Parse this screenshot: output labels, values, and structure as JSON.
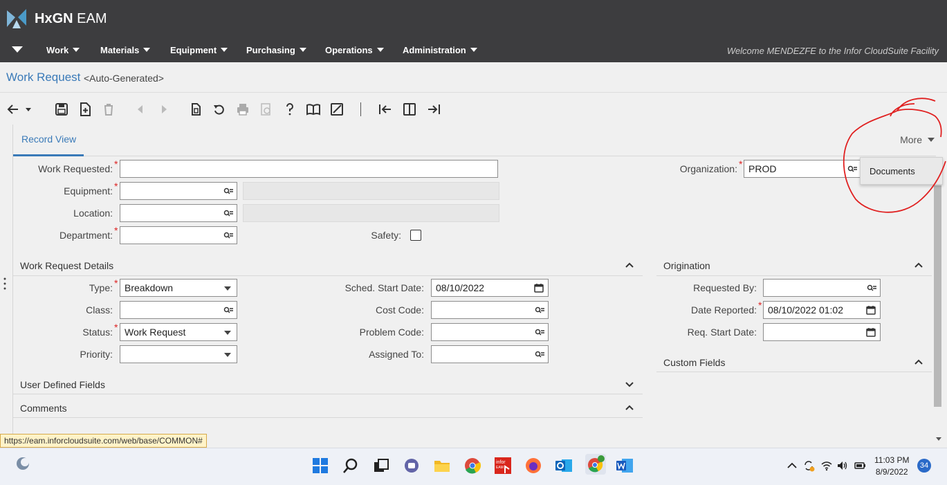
{
  "app": {
    "brand_bold": "HxGN",
    "brand_rest": " EAM"
  },
  "nav": {
    "items": [
      "Work",
      "Materials",
      "Equipment",
      "Purchasing",
      "Operations",
      "Administration"
    ],
    "welcome": "Welcome MENDEZFE to the Infor CloudSuite Facility"
  },
  "title": {
    "main": "Work Request",
    "sub": "<Auto-Generated>"
  },
  "tabs": {
    "record_view": "Record View",
    "more": "More"
  },
  "menu": {
    "documents": "Documents"
  },
  "header_fields": {
    "work_requested": {
      "label": "Work Requested:",
      "value": ""
    },
    "equipment": {
      "label": "Equipment:",
      "value": ""
    },
    "location": {
      "label": "Location:",
      "value": ""
    },
    "department": {
      "label": "Department:",
      "value": ""
    },
    "safety": {
      "label": "Safety:",
      "checked": false
    },
    "organization": {
      "label": "Organization:",
      "value": "PROD"
    }
  },
  "details": {
    "title": "Work Request Details",
    "type": {
      "label": "Type:",
      "value": "Breakdown"
    },
    "class": {
      "label": "Class:",
      "value": ""
    },
    "status": {
      "label": "Status:",
      "value": "Work Request"
    },
    "priority": {
      "label": "Priority:",
      "value": ""
    },
    "sched_start": {
      "label": "Sched. Start Date:",
      "value": "08/10/2022"
    },
    "cost_code": {
      "label": "Cost Code:",
      "value": ""
    },
    "problem_code": {
      "label": "Problem Code:",
      "value": ""
    },
    "assigned_to": {
      "label": "Assigned To:",
      "value": ""
    }
  },
  "origination": {
    "title": "Origination",
    "requested_by": {
      "label": "Requested By:",
      "value": ""
    },
    "date_reported": {
      "label": "Date Reported:",
      "value": "08/10/2022 01:02"
    },
    "req_start": {
      "label": "Req. Start Date:",
      "value": ""
    }
  },
  "sections": {
    "custom_fields": "Custom Fields",
    "user_defined": "User Defined Fields",
    "comments": "Comments"
  },
  "status_url": "https://eam.inforcloudsuite.com/web/base/COMMON#",
  "taskbar": {
    "time": "11:03 PM",
    "date": "8/9/2022",
    "notifications": "34",
    "infor_tile_line1": "infor",
    "infor_tile_line2": "EAM"
  },
  "colors": {
    "header": "#3d3d3f",
    "accent": "#3a7ab8",
    "required": "#d22222",
    "annotation": "#e02020"
  }
}
